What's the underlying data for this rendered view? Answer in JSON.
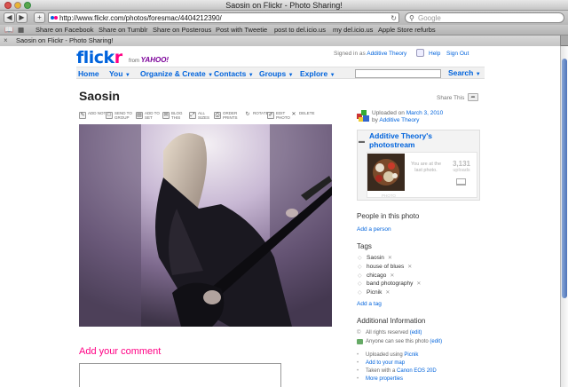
{
  "browser": {
    "window_title": "Saosin on Flickr - Photo Sharing!",
    "url": "http://www.flickr.com/photos/foresmac/4404212390/",
    "search_placeholder": "Google",
    "bookmarks": [
      "Share on Facebook",
      "Share on Tumblr",
      "Share on Posterous",
      "Post with Tweetie",
      "post to del.icio.us",
      "my del.icio.us",
      "Apple Store refurbs"
    ],
    "tab_label": "Saosin on Flickr - Photo Sharing!"
  },
  "header": {
    "logo_part1": "flick",
    "logo_part2": "r",
    "from_label": "from",
    "yahoo_label": "YAHOO!",
    "signed_in_prefix": "Signed in as",
    "signed_in_user": "Additive Theory",
    "help": "Help",
    "sign_out": "Sign Out"
  },
  "nav": {
    "items": [
      "Home",
      "You",
      "Organize & Create",
      "Contacts",
      "Groups",
      "Explore"
    ],
    "search_label": "Search"
  },
  "photo": {
    "title": "Saosin",
    "share_this": "Share This",
    "tools": [
      "ADD NOTE",
      "SEND TO GROUP",
      "ADD TO SET",
      "BLOG THIS",
      "ALL SIZES",
      "ORDER PRINTS",
      "ROTATE",
      "EDIT PHOTO",
      "DELETE"
    ],
    "add_comment": "Add your comment"
  },
  "sidebar": {
    "uploaded_prefix": "Uploaded on",
    "uploaded_date": "March 3, 2010",
    "uploaded_by_prefix": "by",
    "uploaded_by": "Additive Theory",
    "photostream_title": "Additive Theory's photostream",
    "last_photo": "You are at the last photo.",
    "count": "3,131",
    "count_label": "uploads",
    "strip_label": "PHOTO",
    "people_heading": "People in this photo",
    "add_person": "Add a person",
    "tags_heading": "Tags",
    "tags": [
      "Saosin",
      "house of blues",
      "chicago",
      "band photography",
      "Picnik"
    ],
    "add_tag": "Add a tag",
    "info_heading": "Additional Information",
    "rights": "All rights reserved",
    "rights_edit": "(edit)",
    "visibility": "Anyone can see this photo",
    "visibility_edit": "(edit)",
    "uploaded_using_prefix": "Uploaded using",
    "uploaded_using": "Picnik",
    "add_map": "Add to your map",
    "taken_prefix": "Taken with a",
    "camera": "Canon EOS 20D",
    "more_props": "More properties"
  },
  "colors": {
    "flickr_blue": "#0063dc",
    "flickr_pink": "#ff0084"
  }
}
